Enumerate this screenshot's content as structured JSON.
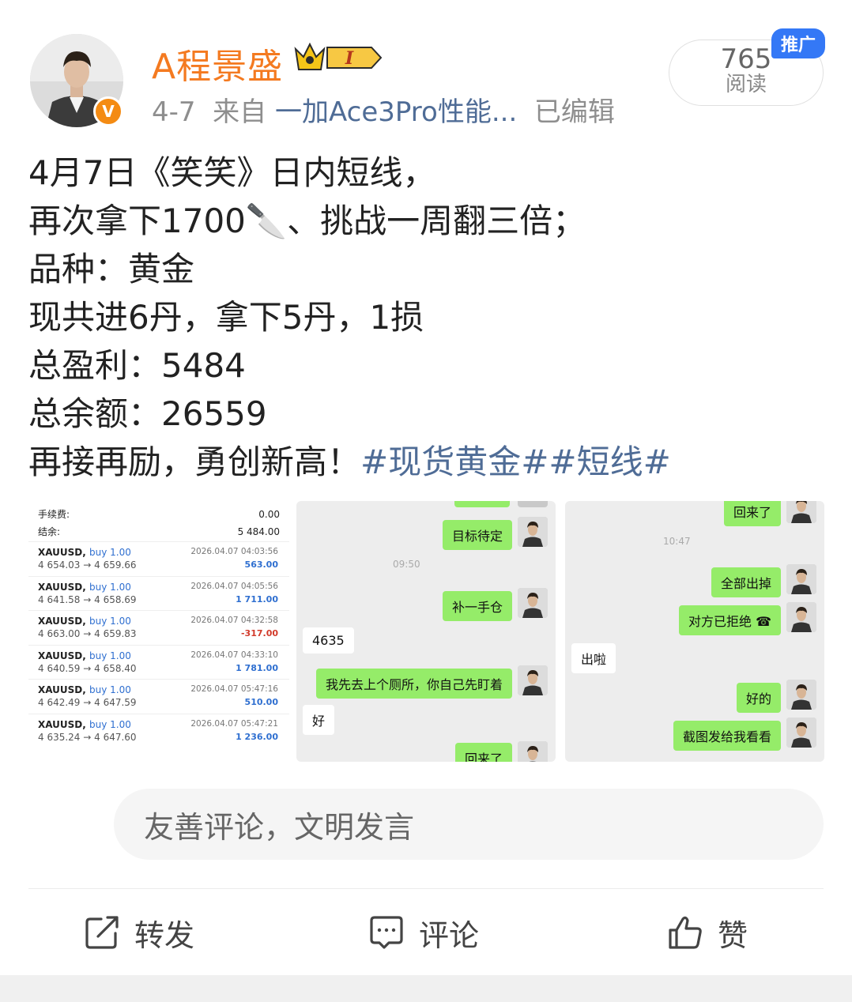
{
  "user": {
    "name": "A程景盛",
    "verified_badge": "V",
    "vip_level": "I",
    "date": "4-7",
    "from_label": "来自",
    "source": "一加Ace3Pro性能...",
    "edited": "已编辑"
  },
  "reads": {
    "count": "765",
    "label": "阅读",
    "promo": "推广"
  },
  "post": {
    "lines": [
      "4月7日《笑笑》日内短线，",
      "再次拿下1700🔪、挑战一周翻三倍；",
      "品种：黄金",
      "现共进6丹，拿下5丹，1损",
      "总盈利：5484",
      "总余额：26559",
      "再接再励，勇创新高！"
    ],
    "hashtags": "#现货黄金##短线#"
  },
  "image1": {
    "fee_label": "手续费:",
    "fee_value": "0.00",
    "balance_label": "结余:",
    "balance_value": "5 484.00",
    "trades": [
      {
        "symbol": "XAUUSD,",
        "side": "buy 1.00",
        "prices": "4 654.03 → 4 659.66",
        "time": "2026.04.07 04:03:56",
        "profit": "563.00",
        "neg": false
      },
      {
        "symbol": "XAUUSD,",
        "side": "buy 1.00",
        "prices": "4 641.58 → 4 658.69",
        "time": "2026.04.07 04:05:56",
        "profit": "1 711.00",
        "neg": false
      },
      {
        "symbol": "XAUUSD,",
        "side": "buy 1.00",
        "prices": "4 663.00 → 4 659.83",
        "time": "2026.04.07 04:32:58",
        "profit": "-317.00",
        "neg": true
      },
      {
        "symbol": "XAUUSD,",
        "side": "buy 1.00",
        "prices": "4 640.59 → 4 658.40",
        "time": "2026.04.07 04:33:10",
        "profit": "1 781.00",
        "neg": false
      },
      {
        "symbol": "XAUUSD,",
        "side": "buy 1.00",
        "prices": "4 642.49 → 4 647.59",
        "time": "2026.04.07 05:47:16",
        "profit": "510.00",
        "neg": false
      },
      {
        "symbol": "XAUUSD,",
        "side": "buy 1.00",
        "prices": "4 635.24 → 4 647.60",
        "time": "2026.04.07 05:47:21",
        "profit": "1 236.00",
        "neg": false
      }
    ]
  },
  "image2": {
    "time": "09:50",
    "msg1": "目标待定",
    "msg2": "补一手仓",
    "msg3": "4635",
    "msg4": "我先去上个厕所，你自己先盯着",
    "msg5": "好",
    "msg6": "回来了"
  },
  "image3": {
    "time": "10:47",
    "msg1": "回来了",
    "msg2": "全部出掉",
    "msg3": "对方已拒绝",
    "msg4": "出啦",
    "msg5": "好的",
    "msg6": "截图发给我看看"
  },
  "comment": {
    "placeholder": "友善评论，文明发言"
  },
  "actions": {
    "repost": "转发",
    "comment": "评论",
    "like": "赞"
  },
  "colors": {
    "username": "#f47a20",
    "link": "#4f6c96",
    "wechat_green": "#95ec69",
    "promo_blue": "#3478f6"
  }
}
